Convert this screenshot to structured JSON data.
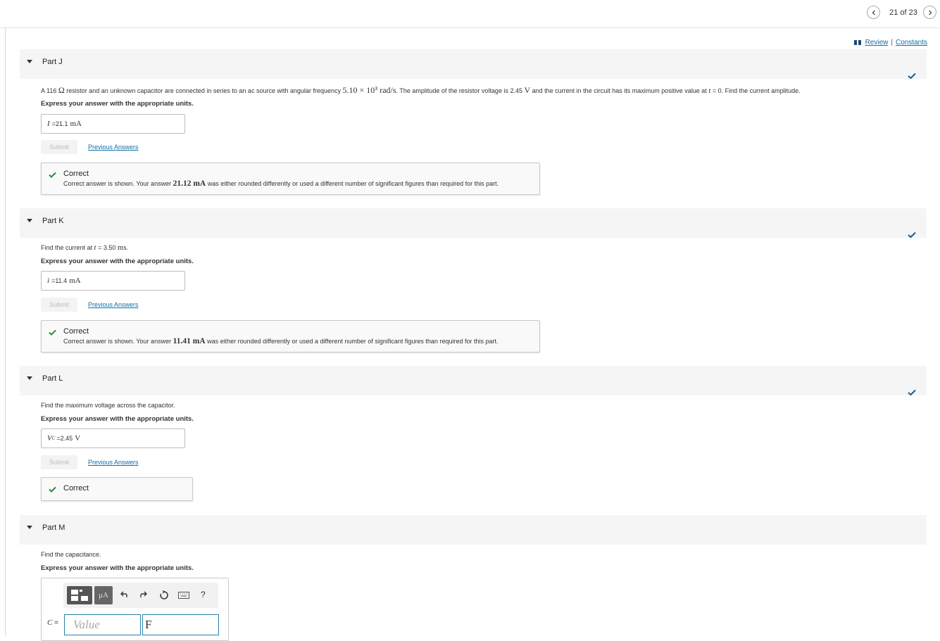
{
  "nav": {
    "page_count": "21 of 23"
  },
  "links": {
    "review": "Review",
    "separator": "|",
    "constants": "Constants"
  },
  "colors": {
    "link": "#0f6fa8",
    "check": "#1c5a8a",
    "correct_icon": "#2e8b3a",
    "input_border": "#2a7fa8"
  },
  "parts": [
    {
      "title": "Part J",
      "question": {
        "t1": "A 116 ",
        "ohm": "Ω",
        "t2": " resistor and an unknown capacitor are connected in series to an ac source with angular frequency ",
        "freq": "5.10 × 10",
        "freq_exp": "3",
        "freq_unit": " rad/s",
        "t3": ". The amplitude of the resistor voltage is 2.45 ",
        "volt": "V",
        "t4": " and the current in the circuit has its maximum positive value at ",
        "tvar": "t",
        "t5": " = 0. Find the current amplitude."
      },
      "instruction": "Express your answer with the appropriate units.",
      "answer": {
        "var": "I",
        "eq": " = ",
        "value": "21.1",
        "unit": "mA"
      },
      "submit": "Submit",
      "previous": "Previous Answers",
      "feedback": {
        "title": "Correct",
        "d1": "Correct answer is shown. Your answer ",
        "val": "21.12 mA",
        "d2": " was either rounded differently or used a different number of significant figures than required for this part."
      }
    },
    {
      "title": "Part K",
      "question": {
        "t1": "Find the current at ",
        "tvar": "t",
        "t2": " = 3.50 ",
        "unit": "ms",
        "t3": "."
      },
      "instruction": "Express your answer with the appropriate units.",
      "answer": {
        "var": "i",
        "eq": " = ",
        "value": "11.4",
        "unit": "mA"
      },
      "submit": "Submit",
      "previous": "Previous Answers",
      "feedback": {
        "title": "Correct",
        "d1": "Correct answer is shown. Your answer ",
        "val": "11.41 mA",
        "d2": " was either rounded differently or used a different number of significant figures than required for this part."
      }
    },
    {
      "title": "Part L",
      "question": {
        "t1": "Find the maximum voltage across the capacitor."
      },
      "instruction": "Express your answer with the appropriate units.",
      "answer": {
        "var": "V",
        "sub": "C",
        "eq": " = ",
        "value": "2.45",
        "unit": "V"
      },
      "submit": "Submit",
      "previous": "Previous Answers",
      "feedback": {
        "title": "Correct"
      }
    },
    {
      "title": "Part M",
      "question": {
        "t1": "Find the capacitance."
      },
      "instruction": "Express your answer with the appropriate units.",
      "editor": {
        "mu_label": "μA",
        "help": "?",
        "var": "C",
        "eq": " = ",
        "value_placeholder": "Value",
        "unit_value": "F"
      }
    }
  ]
}
